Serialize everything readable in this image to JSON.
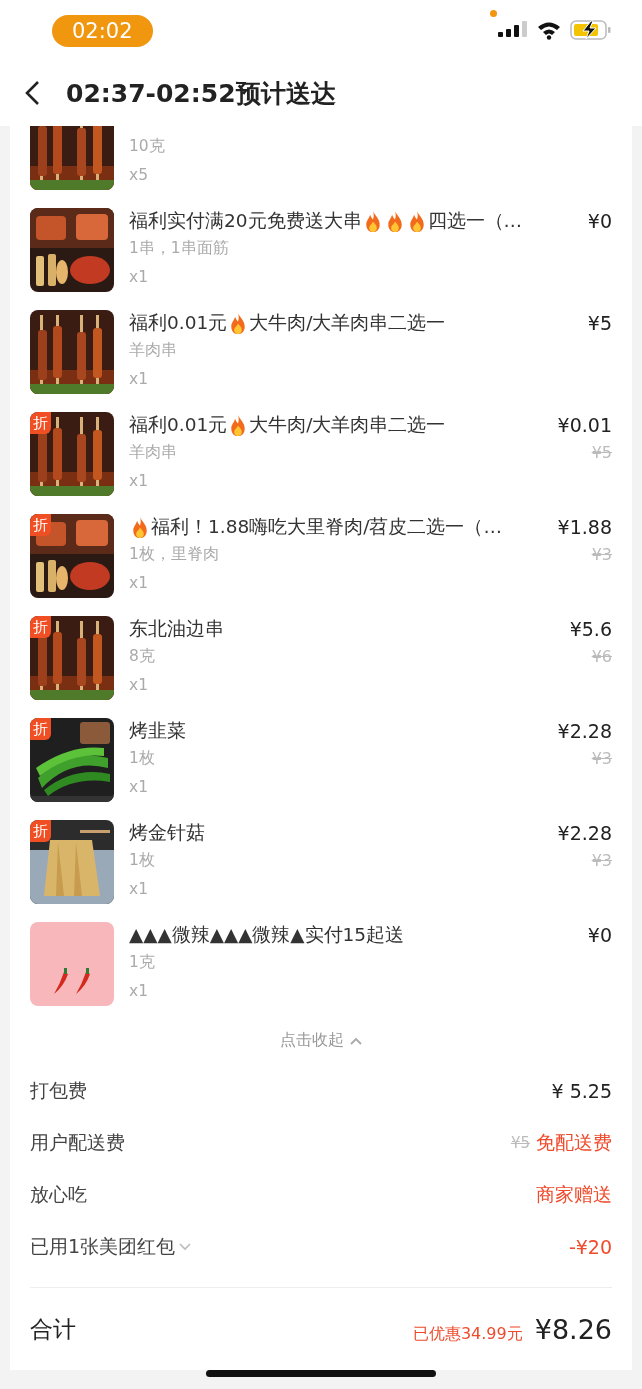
{
  "status_bar": {
    "time": "02:02"
  },
  "header": {
    "title": "02:37-02:52预计送达"
  },
  "items": [
    {
      "clipped": true,
      "kind": "picture",
      "spec": "10克",
      "qty": "x5"
    },
    {
      "kind": "picture",
      "name": [
        {
          "kind": "text",
          "text": "福利实付满20元免费送大串"
        },
        {
          "kind": "fire"
        },
        {
          "kind": "fire"
        },
        {
          "kind": "fire"
        },
        {
          "kind": "text",
          "text": "四选一（…"
        }
      ],
      "spec": "1串，1串面筋",
      "qty": "x1",
      "price": "¥0"
    },
    {
      "kind": "picture",
      "name": [
        {
          "kind": "text",
          "text": "福利0.01元"
        },
        {
          "kind": "fire"
        },
        {
          "kind": "text",
          "text": "大牛肉/大羊肉串二选一"
        }
      ],
      "spec": "羊肉串",
      "qty": "x1",
      "price": "¥5"
    },
    {
      "kind": "picture",
      "badge": "折",
      "name": [
        {
          "kind": "text",
          "text": "福利0.01元"
        },
        {
          "kind": "fire"
        },
        {
          "kind": "text",
          "text": "大牛肉/大羊肉串二选一"
        }
      ],
      "spec": "羊肉串",
      "qty": "x1",
      "price": "¥0.01",
      "original_price": "¥5"
    },
    {
      "kind": "picture",
      "badge": "折",
      "name": [
        {
          "kind": "fire"
        },
        {
          "kind": "text",
          "text": "福利！1.88嗨吃大里脊肉/苕皮二选一（…"
        }
      ],
      "spec": "1枚，里脊肉",
      "qty": "x1",
      "price": "¥1.88",
      "original_price": "¥3"
    },
    {
      "kind": "picture",
      "badge": "折",
      "name": [
        {
          "kind": "text",
          "text": "东北油边串"
        }
      ],
      "spec": "8克",
      "qty": "x1",
      "price": "¥5.6",
      "original_price": "¥6"
    },
    {
      "kind": "picture",
      "badge": "折",
      "name": [
        {
          "kind": "text",
          "text": "烤韭菜"
        }
      ],
      "spec": "1枚",
      "qty": "x1",
      "price": "¥2.28",
      "original_price": "¥3"
    },
    {
      "kind": "picture",
      "badge": "折",
      "name": [
        {
          "kind": "text",
          "text": "烤金针菇"
        }
      ],
      "spec": "1枚",
      "qty": "x1",
      "price": "¥2.28",
      "original_price": "¥3"
    },
    {
      "kind": "picture",
      "name": [
        {
          "kind": "text",
          "text": "▲▲▲微辣▲▲▲微辣▲实付15起送"
        }
      ],
      "spec": "1克",
      "qty": "x1",
      "price": "¥0"
    }
  ],
  "collapse": {
    "label": "点击收起"
  },
  "fees": [
    {
      "kind": "plain",
      "label": "打包费",
      "value": "¥ 5.25"
    },
    {
      "kind": "highlight",
      "label": "用户配送费",
      "original": "¥5",
      "value": "免配送费"
    },
    {
      "kind": "highlight",
      "label": "放心吃",
      "value": "商家赠送"
    },
    {
      "kind": "discount",
      "label": "已用1张美团红包",
      "dropdown": true,
      "value": "-¥20"
    }
  ],
  "total": {
    "label": "合计",
    "saved": "已优惠34.99元",
    "amount": "¥8.26"
  }
}
